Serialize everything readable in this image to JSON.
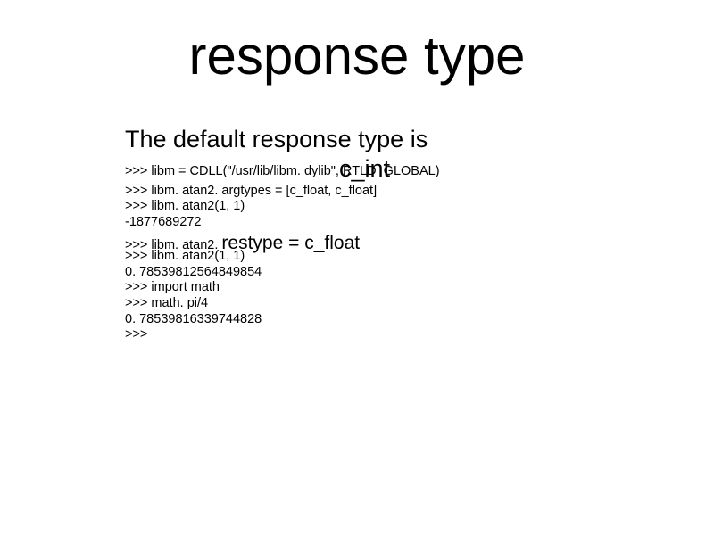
{
  "slide": {
    "title": "response type",
    "lead": "The default response type is",
    "overlap_code": ">>> libm = CDLL(\"/usr/lib/libm. dylib\", RTLD_GLOBAL)",
    "overlap_big": "c_int",
    "code_block_1": ">>> libm. atan2. argtypes = [c_float, c_float]\n>>> libm. atan2(1, 1)\n-1877689272",
    "restype_prefix": ">>> libm. atan2. ",
    "restype_main": "restype = c_float",
    "code_block_2": ">>> libm. atan2(1, 1)\n0. 78539812564849854\n>>> import math\n>>> math. pi/4\n0. 78539816339744828\n>>> "
  }
}
